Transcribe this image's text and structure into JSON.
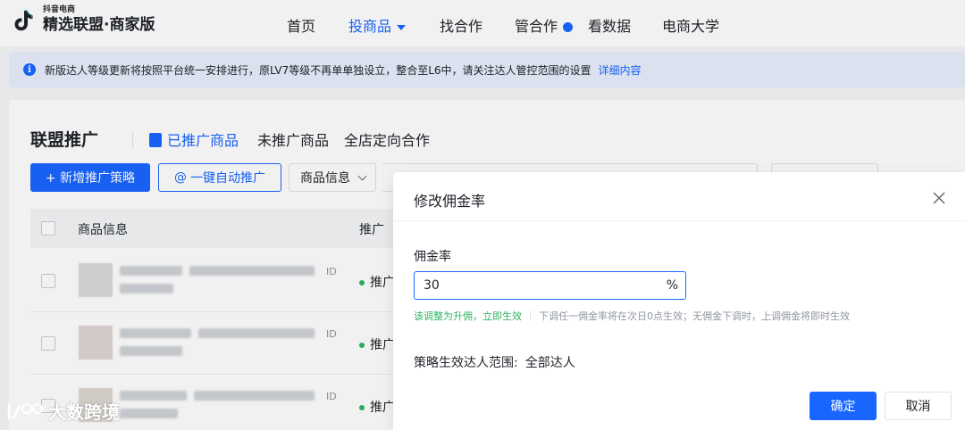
{
  "brand": {
    "small_text": "抖音电商",
    "main_text": "精选联盟·商家版"
  },
  "nav": {
    "items": [
      {
        "label": "首页"
      },
      {
        "label": "投商品"
      },
      {
        "label": "找合作"
      },
      {
        "label": "管合作"
      },
      {
        "label": "看数据"
      },
      {
        "label": "电商大学"
      }
    ],
    "active_index": 1
  },
  "notice": {
    "text": "新版达人等级更新将按照平台统一安排进行，原LV7等级不再单单独设立，整合至L6中，请关注达人管控范围的设置",
    "link": "详细内容"
  },
  "page": {
    "title": "联盟推广",
    "tabs": [
      {
        "label": "已推广商品"
      },
      {
        "label": "未推广商品"
      },
      {
        "label": "全店定向合作"
      }
    ],
    "add_strategy_button": "+ 新增推广策略",
    "auto_promote_button": "一键自动推广",
    "filter_select": "商品信息"
  },
  "table": {
    "headers": {
      "product": "商品信息",
      "status": "推广"
    },
    "rows": [
      {
        "id_tag": "ID",
        "status": "推广"
      },
      {
        "id_tag": "ID",
        "status": "推广"
      },
      {
        "id_tag": "ID",
        "status": "推广"
      }
    ]
  },
  "modal": {
    "title": "修改佣金率",
    "field_label": "佣金率",
    "field_value": "30",
    "field_suffix": "%",
    "hint_green": "该调整为升佣，立即生效",
    "hint_gray": "下调任一佣金率将在次日0点生效；无佣金下调时，上调佣金将即时生效",
    "scope_label": "策略生效达人范围:",
    "scope_value": "全部达人",
    "confirm_button": "确定",
    "cancel_button": "取消"
  },
  "watermark": {
    "text": "大数跨境"
  },
  "colors": {
    "accent": "#1966ff",
    "success": "#2fb361",
    "notice_bg": "#e8effd"
  }
}
